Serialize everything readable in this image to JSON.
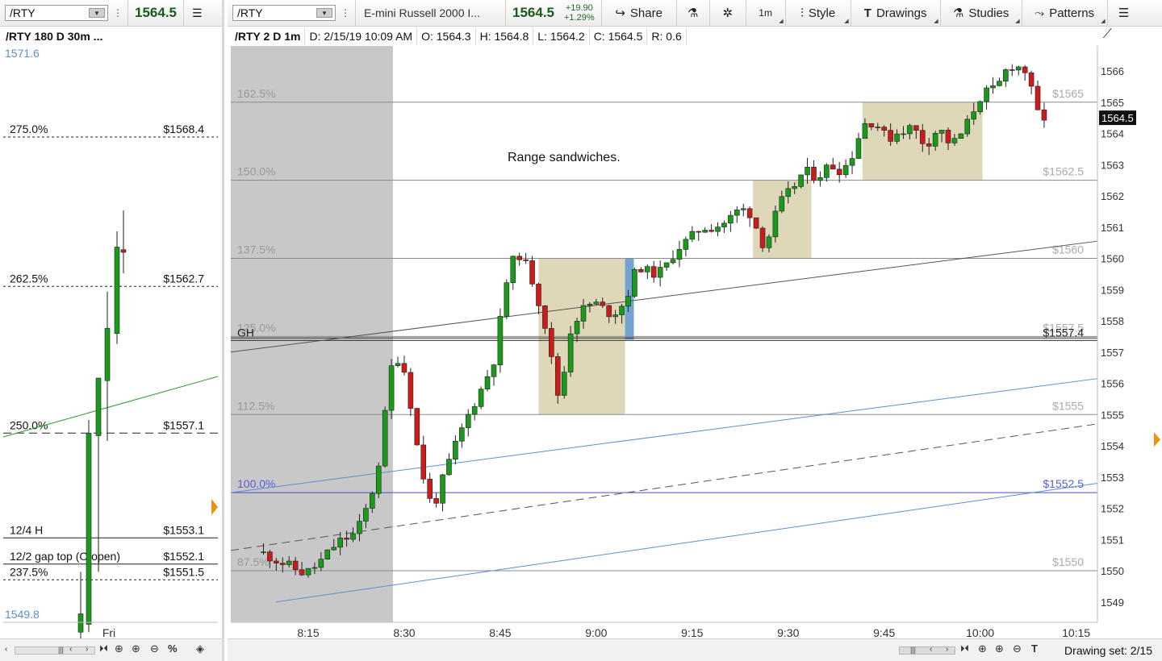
{
  "left": {
    "symbol": "/RTY",
    "last_price": "1564.5",
    "chart_title": "/RTY 180 D 30m ...",
    "top_price": "1571.6",
    "bottom_price": "1549.8",
    "x_label": "Fri",
    "levels": [
      {
        "name": "275.0%",
        "price": "$1568.4",
        "value": 1568.4,
        "style": "dotted"
      },
      {
        "name": "262.5%",
        "price": "$1562.7",
        "value": 1562.7,
        "style": "dotted"
      },
      {
        "name": "250.0%",
        "price": "$1557.1",
        "value": 1557.1,
        "style": "dashed"
      },
      {
        "name": "12/4 H",
        "price": "$1553.1",
        "value": 1553.1,
        "style": "solid"
      },
      {
        "name": "12/2 gap top (O open)",
        "price": "$1552.1",
        "value": 1552.1,
        "style": "solid"
      },
      {
        "name": "237.5%",
        "price": "$1551.5",
        "value": 1551.5,
        "style": "dotted"
      }
    ],
    "candles": [
      {
        "o": 1549.5,
        "h": 1551.8,
        "l": 1547.0,
        "c": 1550.2
      },
      {
        "o": 1549.8,
        "h": 1557.6,
        "l": 1549.5,
        "c": 1557.1
      },
      {
        "o": 1557.0,
        "h": 1559.0,
        "l": 1551.8,
        "c": 1559.2
      },
      {
        "o": 1559.1,
        "h": 1562.5,
        "l": 1556.8,
        "c": 1561.1
      },
      {
        "o": 1560.9,
        "h": 1564.8,
        "l": 1560.5,
        "c": 1564.2
      },
      {
        "o": 1564.1,
        "h": 1565.6,
        "l": 1563.2,
        "c": 1564.0
      }
    ]
  },
  "right": {
    "symbol": "/RTY",
    "instrument_name": "E-mini Russell 2000 I...",
    "last_price": "1564.5",
    "change_abs": "+19.90",
    "change_pct": "+1.29%",
    "buttons": {
      "share": "Share",
      "interval": "1m",
      "style": "Style",
      "drawings": "Drawings",
      "studies": "Studies",
      "patterns": "Patterns"
    },
    "info": {
      "title": "/RTY 2 D 1m",
      "date": "D: 2/15/19 10:09 AM",
      "open": "O: 1564.3",
      "high": "H: 1564.8",
      "low": "L: 1564.2",
      "close": "C: 1564.5",
      "range": "R: 0.6"
    },
    "annotation": "Range sandwiches.",
    "price_marker": "1564.5",
    "drawing_set": "Drawing set: 2/15",
    "y_ticks": [
      "1567",
      "1566",
      "1565",
      "1564",
      "1563",
      "1562",
      "1561",
      "1560",
      "1559",
      "1558",
      "1557",
      "1556",
      "1555",
      "1554",
      "1553",
      "1552",
      "1551",
      "1550",
      "1549"
    ],
    "x_ticks": [
      "8:15",
      "8:30",
      "8:45",
      "9:00",
      "9:15",
      "9:30",
      "9:45",
      "10:00",
      "10:15"
    ],
    "levels": [
      {
        "name": "162.5%",
        "price": "$1565",
        "value": 1565.0
      },
      {
        "name": "150.0%",
        "price": "$1562.5",
        "value": 1562.5
      },
      {
        "name": "137.5%",
        "price": "$1560",
        "value": 1560.0
      },
      {
        "name": "125.0%",
        "price": "$1557.5",
        "value": 1557.5
      },
      {
        "name": "112.5%",
        "price": "$1555",
        "value": 1555.0
      },
      {
        "name": "100.0%",
        "price": "$1552.5",
        "value": 1552.5,
        "color": "#4a4ad6"
      },
      {
        "name": "87.5%",
        "price": "$1550",
        "value": 1550.0
      }
    ],
    "gh_label": "GH",
    "gh_price": "$1557.4",
    "gh_value": 1557.4,
    "colors": {
      "up": "#1a9a1a",
      "down": "#cc1b1b",
      "box": "#dcd5b4",
      "blue_box": "#6a9fd0",
      "session": "#c8c8c8"
    }
  }
}
